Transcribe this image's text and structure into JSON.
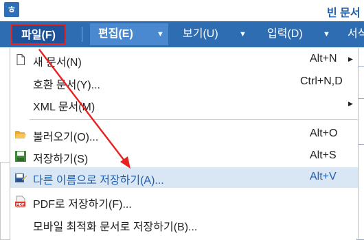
{
  "window": {
    "title": "빈 문서"
  },
  "menubar": {
    "file": "파일(F)",
    "edit": "편집(E)",
    "view": "보기(U)",
    "insert": "입력(D)",
    "format": "서식"
  },
  "file_menu": {
    "items": [
      {
        "label": "새 문서(N)",
        "shortcut": "Alt+N",
        "submenu": true,
        "icon": "new-document-icon"
      },
      {
        "label": "호환 문서(Y)...",
        "shortcut": "Ctrl+N,D",
        "submenu": false,
        "icon": ""
      },
      {
        "label": "XML 문서(M)",
        "shortcut": "",
        "submenu": true,
        "icon": ""
      },
      {
        "label": "불러오기(O)...",
        "shortcut": "Alt+O",
        "submenu": false,
        "icon": "open-folder-icon"
      },
      {
        "label": "저장하기(S)",
        "shortcut": "Alt+S",
        "submenu": false,
        "icon": "save-icon"
      },
      {
        "label": "다른 이름으로 저장하기(A)...",
        "shortcut": "Alt+V",
        "submenu": false,
        "icon": "save-as-icon",
        "highlighted": true
      },
      {
        "label": "PDF로 저장하기(F)...",
        "shortcut": "",
        "submenu": false,
        "icon": "pdf-icon"
      },
      {
        "label": "모바일 최적화 문서로 저장하기(B)...",
        "shortcut": "",
        "submenu": false,
        "icon": ""
      }
    ]
  },
  "colors": {
    "menubar": "#2f6db3",
    "highlight": "#d9e6f4",
    "annotation": "#e82020"
  }
}
